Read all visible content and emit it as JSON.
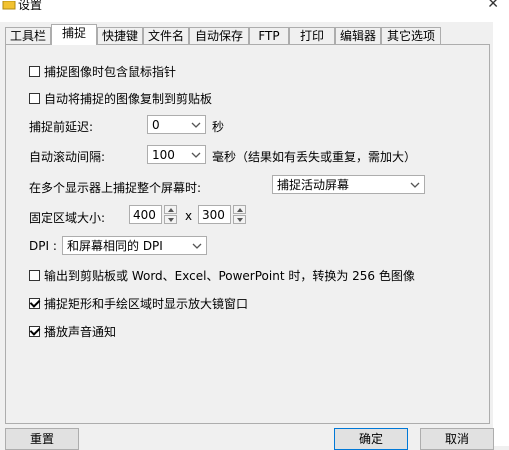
{
  "window": {
    "title": "设置"
  },
  "tabs": [
    {
      "label": "工具栏"
    },
    {
      "label": "捕捉",
      "active": true
    },
    {
      "label": "快捷键"
    },
    {
      "label": "文件名"
    },
    {
      "label": "自动保存"
    },
    {
      "label": "FTP"
    },
    {
      "label": "打印"
    },
    {
      "label": "编辑器"
    },
    {
      "label": "其它选项"
    }
  ],
  "capture": {
    "include_cursor": {
      "label": "捕捉图像时包含鼠标指针",
      "checked": false
    },
    "copy_clipboard": {
      "label": "自动将捕捉的图像复制到剪贴板",
      "checked": false
    },
    "delay_label": "捕捉前延迟:",
    "delay_value": "0",
    "delay_unit": "秒",
    "scroll_label": "自动滚动间隔:",
    "scroll_value": "100",
    "scroll_unit": "毫秒（结果如有丢失或重复，需加大）",
    "multi_monitor_label": "在多个显示器上捕捉整个屏幕时:",
    "multi_monitor_value": "捕捉活动屏幕",
    "fixed_region_label": "固定区域大小:",
    "fixed_width": "400",
    "times": "x",
    "fixed_height": "300",
    "dpi_label": "DPI :",
    "dpi_value": "和屏幕相同的 DPI",
    "convert_256": {
      "label": "输出到剪贴板或 Word、Excel、PowerPoint 时，转换为 256 色图像",
      "checked": false
    },
    "magnifier": {
      "label": "捕捉矩形和手绘区域时显示放大镜窗口",
      "checked": true
    },
    "sound": {
      "label": "播放声音通知",
      "checked": true
    }
  },
  "buttons": {
    "reset": "重置",
    "ok": "确定",
    "cancel": "取消"
  }
}
